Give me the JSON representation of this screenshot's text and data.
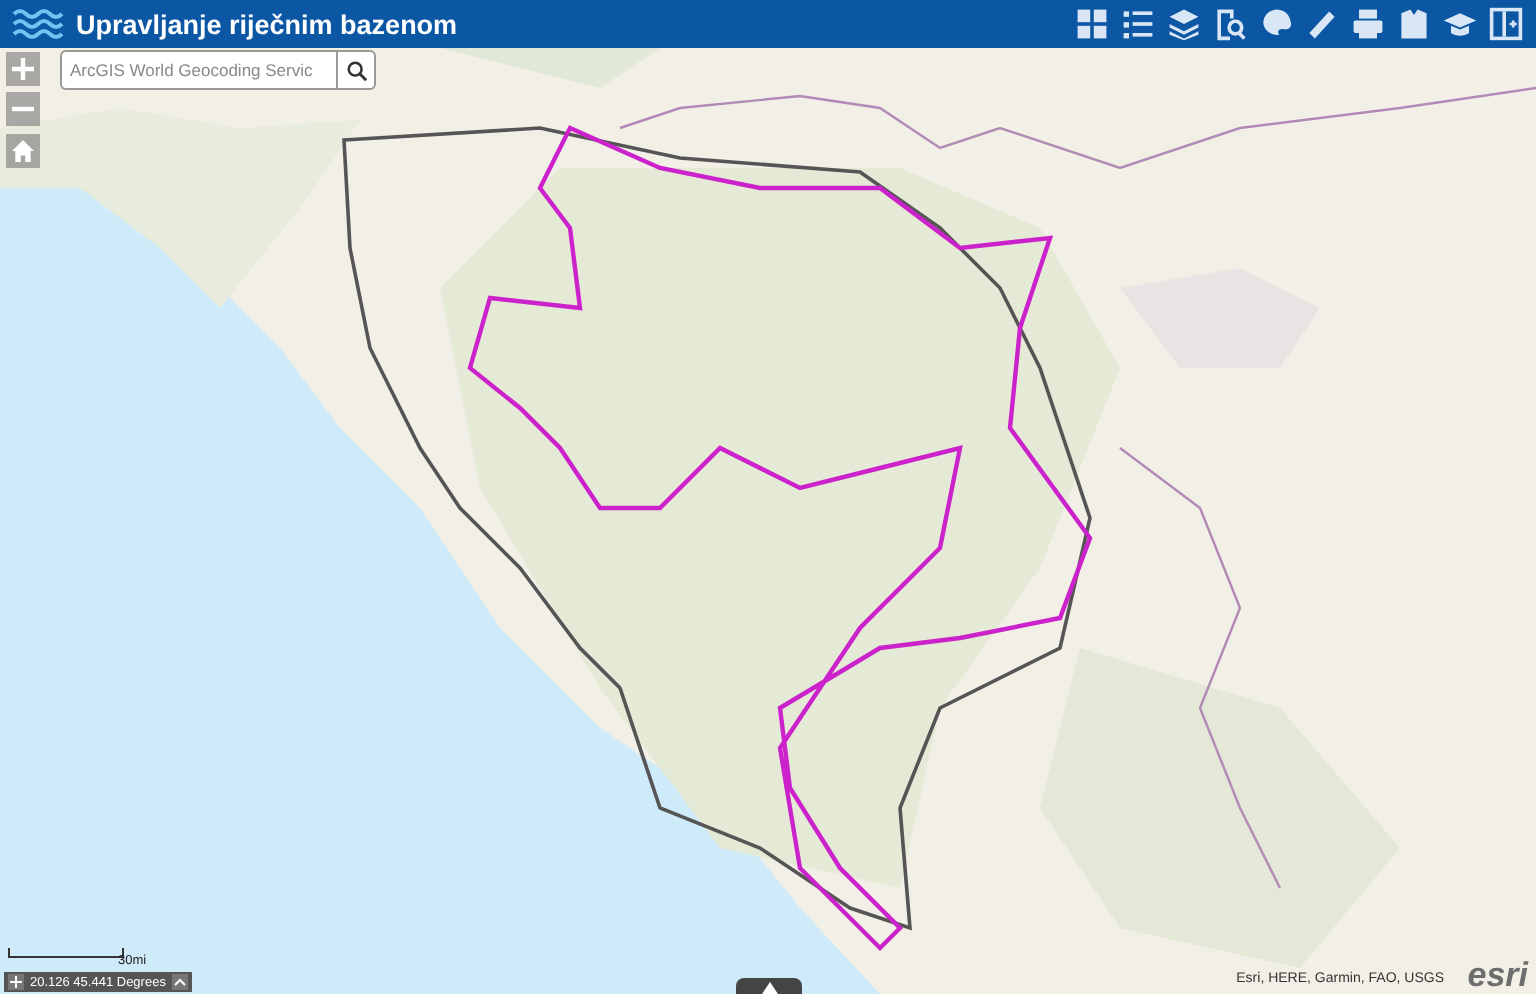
{
  "header": {
    "title": "Upravljanje riječnim bazenom"
  },
  "search": {
    "placeholder": "ArcGIS World Geocoding Servic"
  },
  "scale_bar": {
    "label": "30mi"
  },
  "coordinates": {
    "text": "20.126 45.441 Degrees"
  },
  "attribution": {
    "text": "Esri, HERE, Garmin, FAO, USGS",
    "logo": "esri"
  }
}
